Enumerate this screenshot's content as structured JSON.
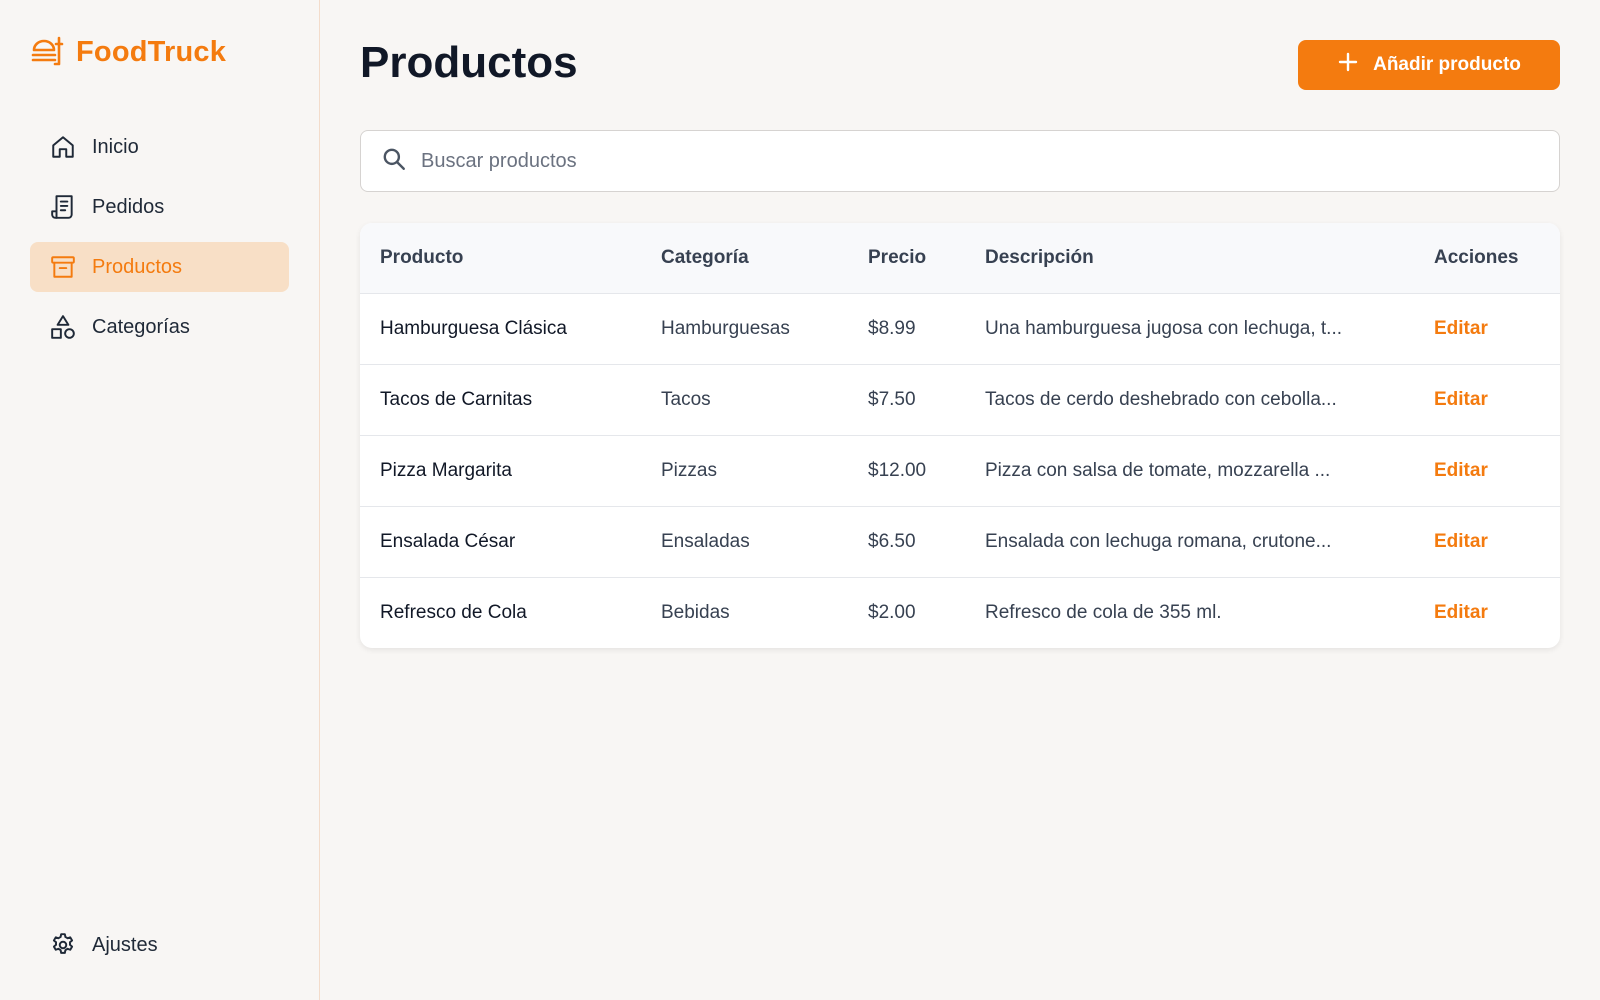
{
  "brand": {
    "name": "FoodTruck"
  },
  "sidebar": {
    "items": [
      {
        "label": "Inicio",
        "icon": "home-icon",
        "active": false
      },
      {
        "label": "Pedidos",
        "icon": "receipt-icon",
        "active": false
      },
      {
        "label": "Productos",
        "icon": "archive-box-icon",
        "active": true
      },
      {
        "label": "Categorías",
        "icon": "shapes-icon",
        "active": false
      }
    ],
    "settings": {
      "label": "Ajustes",
      "icon": "gear-icon"
    }
  },
  "header": {
    "title": "Productos",
    "add_button_label": "Añadir producto"
  },
  "search": {
    "placeholder": "Buscar productos"
  },
  "table": {
    "columns": [
      "Producto",
      "Categoría",
      "Precio",
      "Descripción",
      "Acciones"
    ],
    "rows": [
      {
        "product": "Hamburguesa Clásica",
        "category": "Hamburguesas",
        "price": "$8.99",
        "description": "Una hamburguesa jugosa con lechuga, t...",
        "action": "Editar"
      },
      {
        "product": "Tacos de Carnitas",
        "category": "Tacos",
        "price": "$7.50",
        "description": "Tacos de cerdo deshebrado con cebolla...",
        "action": "Editar"
      },
      {
        "product": "Pizza Margarita",
        "category": "Pizzas",
        "price": "$12.00",
        "description": "Pizza con salsa de tomate, mozzarella ...",
        "action": "Editar"
      },
      {
        "product": "Ensalada César",
        "category": "Ensaladas",
        "price": "$6.50",
        "description": "Ensalada con lechuga romana, crutone...",
        "action": "Editar"
      },
      {
        "product": "Refresco de Cola",
        "category": "Bebidas",
        "price": "$2.00",
        "description": "Refresco de cola de 355 ml.",
        "action": "Editar"
      }
    ]
  },
  "colors": {
    "accent": "#f47b0f",
    "active_bg": "#f8dfc6",
    "background": "#f8f6f4"
  }
}
